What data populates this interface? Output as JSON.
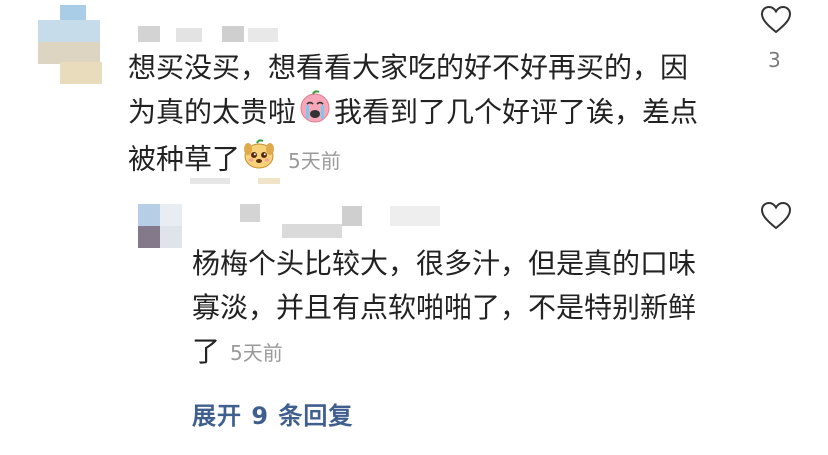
{
  "comment": {
    "lines": [
      "想买没买，想看看大家吃的好不好再买的，因",
      "为真的太贵啦",
      "我看到了几个好评了诶，差点",
      "被种草了"
    ],
    "time": "5天前",
    "like_count": "3",
    "emoji_1": "crying-face-emoji",
    "emoji_2": "cute-dog-emoji"
  },
  "reply": {
    "lines": [
      "杨梅个头比较大，很多汁，但是真的口味",
      "寡淡，并且有点软啪啪了，不是特别新鲜",
      "了"
    ],
    "time": "5天前"
  },
  "expand_label": "展开 9 条回复",
  "colors": {
    "link": "#3f5f8f",
    "time": "#9a9a9a",
    "text": "#222222"
  }
}
